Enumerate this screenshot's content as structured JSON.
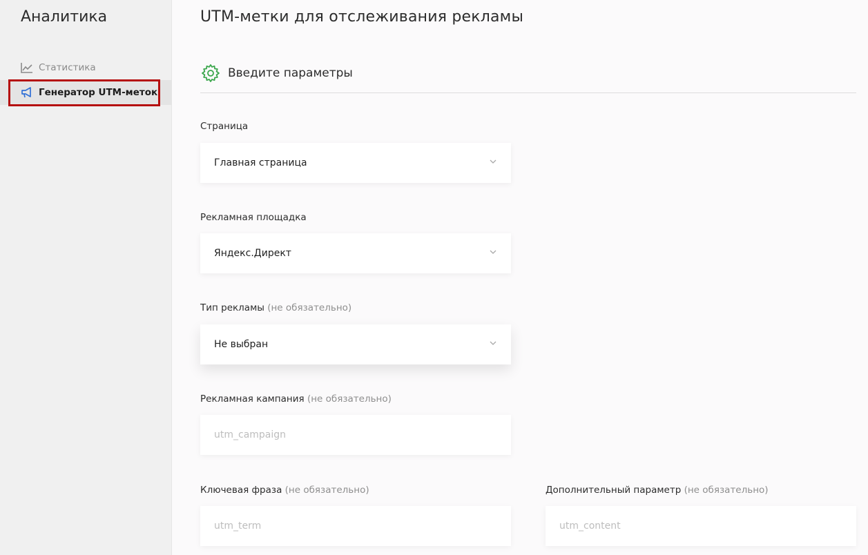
{
  "sidebar": {
    "title": "Аналитика",
    "items": [
      {
        "label": "Статистика",
        "icon": "chart-line-icon"
      },
      {
        "label": "Генератор UTM-меток",
        "icon": "megaphone-icon"
      }
    ],
    "highlight_color": "#b50f0f"
  },
  "main": {
    "title": "UTM-метки для отслеживания рекламы",
    "section": {
      "title": "Введите параметры",
      "icon": "gear-icon",
      "icon_color": "#3aa64b"
    },
    "fields": {
      "page": {
        "label": "Страница",
        "value": "Главная страница"
      },
      "platform": {
        "label": "Рекламная площадка",
        "value": "Яндекс.Директ"
      },
      "ad_type": {
        "label": "Тип рекламы",
        "optional": "(не обязательно)",
        "value": "Не выбран"
      },
      "campaign": {
        "label": "Рекламная кампания",
        "optional": "(не обязательно)",
        "placeholder": "utm_campaign",
        "value": ""
      },
      "term": {
        "label": "Ключевая фраза",
        "optional": "(не обязательно)",
        "placeholder": "utm_term",
        "value": ""
      },
      "content": {
        "label": "Дополнительный параметр",
        "optional": "(не обязательно)",
        "placeholder": "utm_content",
        "value": ""
      }
    }
  }
}
